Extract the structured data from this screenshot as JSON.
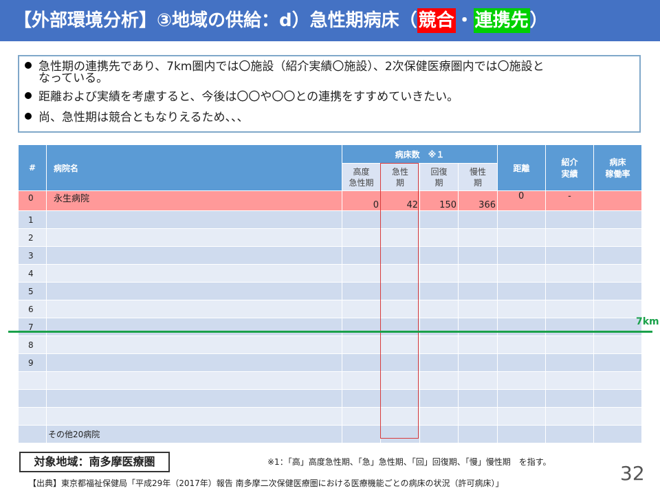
{
  "title": {
    "main": "【外部環境分析】③地域の供給：d）急性期病床（",
    "tag_competition": "競合",
    "separator": "・",
    "tag_partner": "連携先",
    "close": "）"
  },
  "colors": {
    "title_bg": "#4472c4",
    "competition": "#ff0000",
    "partner": "#00d000",
    "row_highlight": "#ff9999",
    "km_line": "#1aa14a"
  },
  "bullets": [
    "急性期の連携先であり、7km圏内では〇施設（紹介実績〇施設）、2次保健医療圏内では〇施設と",
    "なっている。",
    "距離および実績を考慮すると、今後は〇〇や〇〇との連携をすすめていきたい。",
    "尚、急性期は競合ともなりえるため、、、"
  ],
  "table": {
    "headers": {
      "index": "#",
      "hospital": "病院名",
      "beds": "病床数　※１",
      "high_acute_1": "高度",
      "high_acute_2": "急性期",
      "acute_1": "急性",
      "acute_2": "期",
      "recovery_1": "回復",
      "recovery_2": "期",
      "chronic_1": "慢性",
      "chronic_2": "期",
      "distance": "距離",
      "referral_1": "紹介",
      "referral_2": "実績",
      "utilization_1": "病床",
      "utilization_2": "稼働率"
    },
    "row0": {
      "index": "0",
      "name": "永生病院",
      "high_acute": "0",
      "acute": "42",
      "recovery": "150",
      "chronic": "366",
      "distance": "0",
      "referral": "-"
    },
    "indices": [
      "1",
      "2",
      "3",
      "4",
      "5",
      "6",
      "7",
      "8",
      "9"
    ],
    "other": "その他20病院"
  },
  "km_label": "7km",
  "area_label": "対象地域：南多摩医療圏",
  "note": "※1：「高」高度急性期、「急」急性期、「回」回復期、「慢」慢性期　を指す。",
  "page_number": "32",
  "source": "【出典】東京都福祉保健局「平成29年（2017年）報告 南多摩二次保健医療圏における医療機能ごとの病床の状況（許可病床）」"
}
